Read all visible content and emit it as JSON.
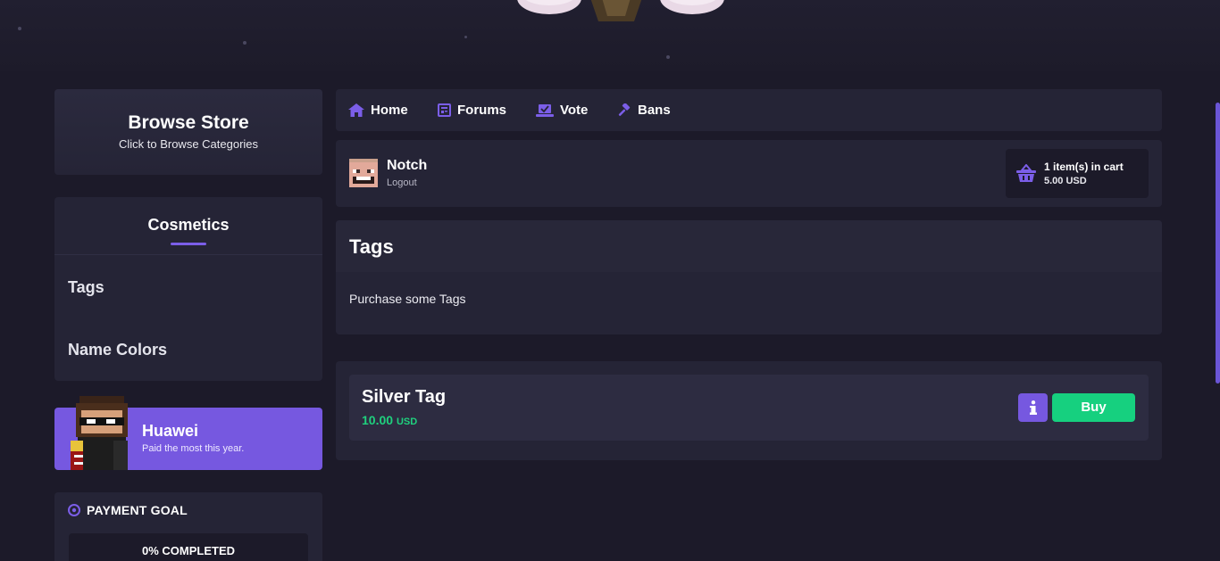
{
  "sidebar": {
    "browse": {
      "title": "Browse Store",
      "subtitle": "Click to Browse Categories"
    },
    "categories": {
      "title": "Cosmetics",
      "items": [
        {
          "label": "Tags"
        },
        {
          "label": "Name Colors"
        }
      ]
    },
    "top_customer": {
      "name": "Huawei",
      "subtitle": "Paid the most this year."
    },
    "payment_goal": {
      "title": "PAYMENT GOAL",
      "progress_label": "0% COMPLETED",
      "progress": 0
    }
  },
  "nav": {
    "items": [
      {
        "label": "Home",
        "icon": "home-icon"
      },
      {
        "label": "Forums",
        "icon": "newspaper-icon"
      },
      {
        "label": "Vote",
        "icon": "laptop-check-icon"
      },
      {
        "label": "Bans",
        "icon": "gavel-icon"
      }
    ]
  },
  "user": {
    "name": "Notch",
    "logout_label": "Logout"
  },
  "cart": {
    "count_label": "1 item(s) in cart",
    "total_label": "5.00 USD"
  },
  "category_page": {
    "title": "Tags",
    "description": "Purchase some Tags"
  },
  "packages": [
    {
      "name": "Silver Tag",
      "price": "10.00",
      "currency": "USD",
      "buy_label": "Buy"
    }
  ],
  "colors": {
    "background": "#1c1a29",
    "card": "#252436",
    "accent": "#7658e0",
    "success": "#16d07f",
    "price": "#1fd17e"
  }
}
